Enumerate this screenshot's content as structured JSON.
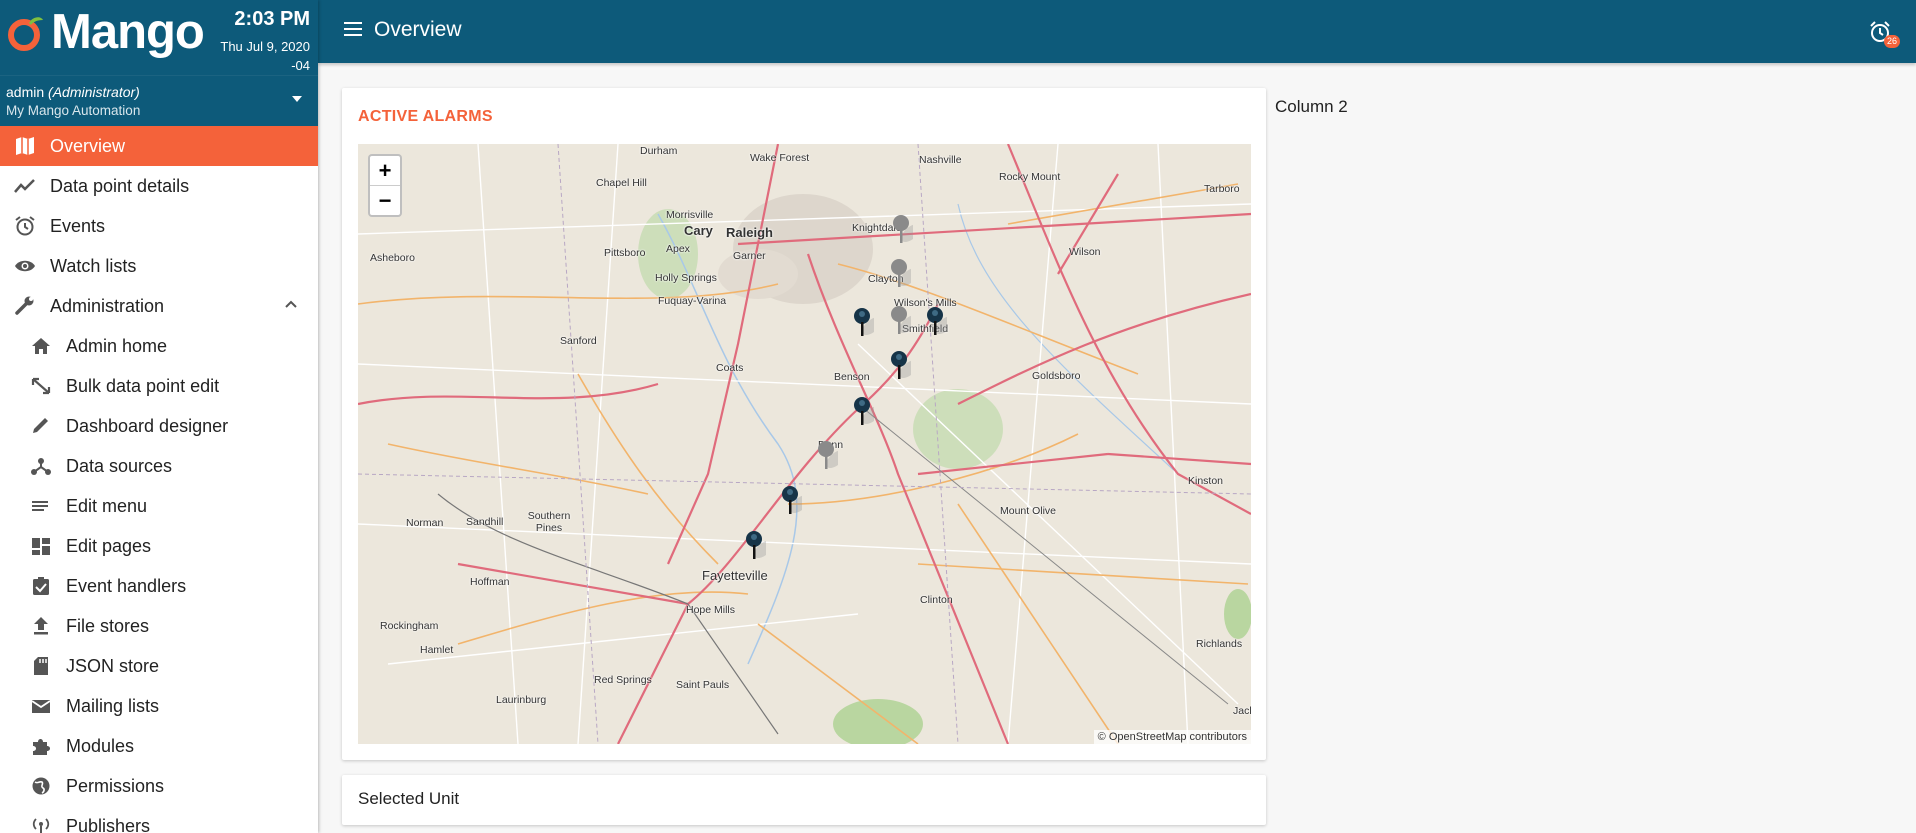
{
  "app": {
    "logo_text": "Mango",
    "time": "2:03 PM",
    "date_line1": "Thu Jul 9, 2020",
    "date_line2": "-04",
    "user_name": "admin",
    "user_role": "(Administrator)",
    "site_name": "My Mango Automation",
    "brand_color": "#0d5a7a",
    "accent_color": "#f4623a"
  },
  "topbar": {
    "page_title": "Overview",
    "alarm_count": "26",
    "menu_icon": "hamburger-icon",
    "alarm_icon": "alarm-clock-icon"
  },
  "sidebar": {
    "items": [
      {
        "label": "Overview",
        "icon": "map-icon",
        "active": true
      },
      {
        "label": "Data point details",
        "icon": "chart-line-icon"
      },
      {
        "label": "Events",
        "icon": "alarm-icon"
      },
      {
        "label": "Watch lists",
        "icon": "eye-icon"
      },
      {
        "label": "Administration",
        "icon": "wrench-icon",
        "expanded": true
      }
    ],
    "admin_items": [
      {
        "label": "Admin home",
        "icon": "home-icon"
      },
      {
        "label": "Bulk data point edit",
        "icon": "resize-icon"
      },
      {
        "label": "Dashboard designer",
        "icon": "pencil-icon"
      },
      {
        "label": "Data sources",
        "icon": "hub-icon"
      },
      {
        "label": "Edit menu",
        "icon": "list-icon"
      },
      {
        "label": "Edit pages",
        "icon": "dashboard-icon"
      },
      {
        "label": "Event handlers",
        "icon": "clipboard-check-icon"
      },
      {
        "label": "File stores",
        "icon": "upload-icon"
      },
      {
        "label": "JSON store",
        "icon": "sd-card-icon"
      },
      {
        "label": "Mailing lists",
        "icon": "mail-icon"
      },
      {
        "label": "Modules",
        "icon": "puzzle-icon"
      },
      {
        "label": "Permissions",
        "icon": "globe-icon"
      },
      {
        "label": "Publishers",
        "icon": "antenna-icon"
      }
    ]
  },
  "main": {
    "card_title": "ACTIVE ALARMS",
    "column2_label": "Column 2",
    "selected_unit_label": "Selected Unit",
    "map": {
      "zoom_in": "+",
      "zoom_out": "−",
      "attribution": "© OpenStreetMap contributors",
      "places": [
        "Durham",
        "Wake Forest",
        "Nashville",
        "Rocky Mount",
        "Chapel Hill",
        "Tarboro",
        "Morrisville",
        "Cary",
        "Raleigh",
        "Knightdale",
        "Apex",
        "Garner",
        "Asheboro",
        "Pittsboro",
        "Wilson",
        "Holly Springs",
        "Clayton",
        "Wilson's Mills",
        "Fuquay-Varina",
        "Smithfield",
        "Sanford",
        "Coats",
        "Benson",
        "Goldsboro",
        "Dunn",
        "Kinston",
        "Norman",
        "Sandhill",
        "Southern Pines",
        "Mount Olive",
        "Fayetteville",
        "Hoffman",
        "Hope Mills",
        "Clinton",
        "Rockingham",
        "Hamlet",
        "Richlands",
        "Red Springs",
        "Saint Pauls",
        "Laurinburg",
        "Jack"
      ]
    }
  }
}
